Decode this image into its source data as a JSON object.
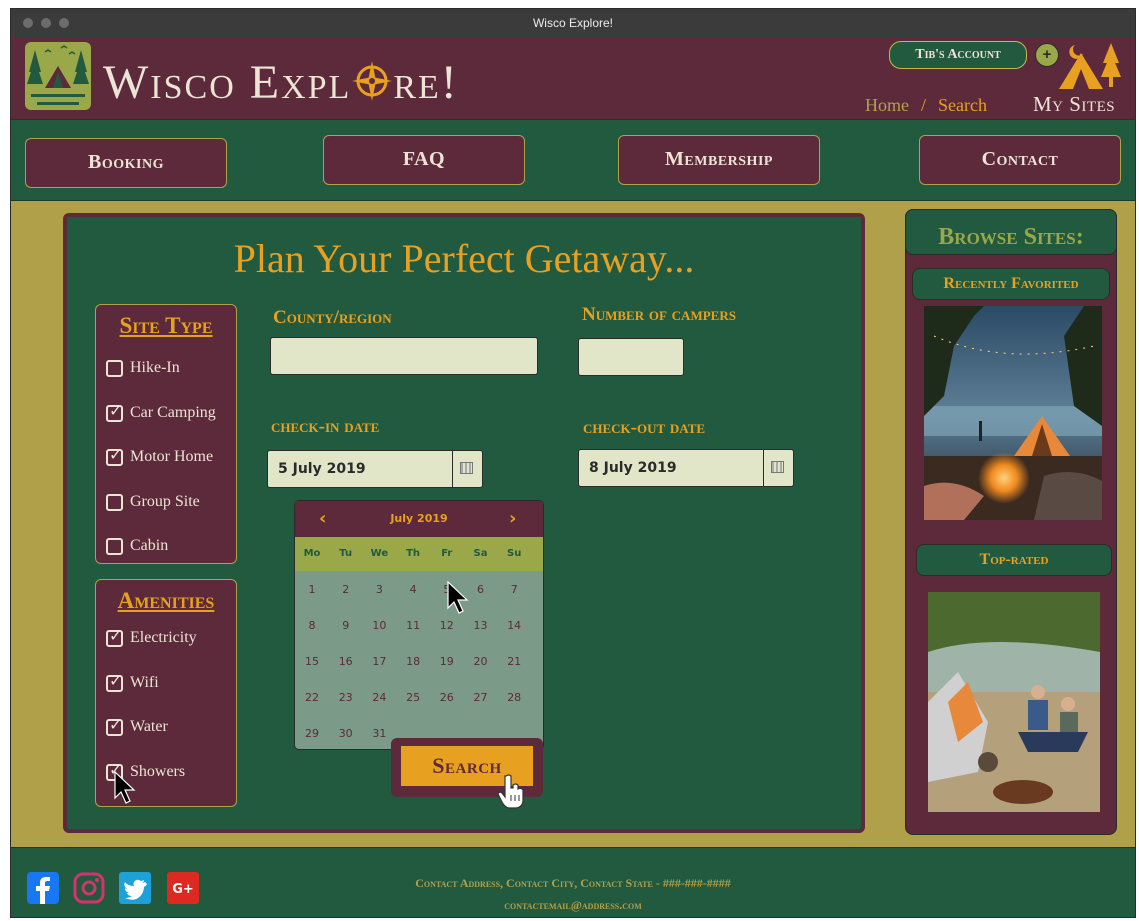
{
  "window": {
    "title": "Wisco Explore!"
  },
  "header": {
    "brand": "Wisco  Expl⊕re!",
    "brand_left": "Wisco  Expl",
    "brand_right": "re!",
    "account": "Tib's Account",
    "plus": "+",
    "breadcrumbs": [
      "Home",
      "/",
      "Search"
    ],
    "my_sites": "My Sites"
  },
  "nav": {
    "booking": "Booking",
    "faq": "FAQ",
    "membership": "Membership",
    "contact": "Contact"
  },
  "main": {
    "heading": "Plan Your Perfect Getaway...",
    "site_type": {
      "title": "Site Type",
      "options": [
        {
          "label": "Hike-In",
          "checked": false
        },
        {
          "label": "Car Camping",
          "checked": true
        },
        {
          "label": "Motor Home",
          "checked": true
        },
        {
          "label": "Group Site",
          "checked": false
        },
        {
          "label": "Cabin",
          "checked": false
        }
      ]
    },
    "amenities": {
      "title": "Amenities",
      "options": [
        {
          "label": "Electricity",
          "checked": true
        },
        {
          "label": "Wifi",
          "checked": true
        },
        {
          "label": "Water",
          "checked": true
        },
        {
          "label": "Showers",
          "checked": true
        }
      ]
    },
    "county_label": "County/region",
    "county_value": "",
    "campers_label": "Number of campers",
    "campers_value": "",
    "checkin_label": "check-in date",
    "checkin_value": "5 July 2019",
    "checkout_label": "check-out date",
    "checkout_value": "8 July 2019",
    "calendar": {
      "month": "July 2019",
      "prev": "‹",
      "next": "›",
      "days_of_week": [
        "Mo",
        "Tu",
        "We",
        "Th",
        "Fr",
        "Sa",
        "Su"
      ],
      "weeks": [
        [
          "1",
          "2",
          "3",
          "4",
          "5",
          "6",
          "7"
        ],
        [
          "8",
          "9",
          "10",
          "11",
          "12",
          "13",
          "14"
        ],
        [
          "15",
          "16",
          "17",
          "18",
          "19",
          "20",
          "21"
        ],
        [
          "22",
          "23",
          "24",
          "25",
          "26",
          "27",
          "28"
        ],
        [
          "29",
          "30",
          "31"
        ]
      ]
    },
    "search_label": "Search"
  },
  "browse": {
    "title": "Browse Sites:",
    "recent": "Recently Favorited",
    "top": "Top-rated"
  },
  "footer": {
    "address": "Contact Address, Contact City, Contact State - ###-###-####",
    "email": "contactemail@address.com"
  },
  "colors": {
    "maroon": "#5c2a3a",
    "green": "#225a40",
    "olive": "#b1a04a",
    "orange": "#e8a020",
    "cream": "#ece4d4"
  }
}
